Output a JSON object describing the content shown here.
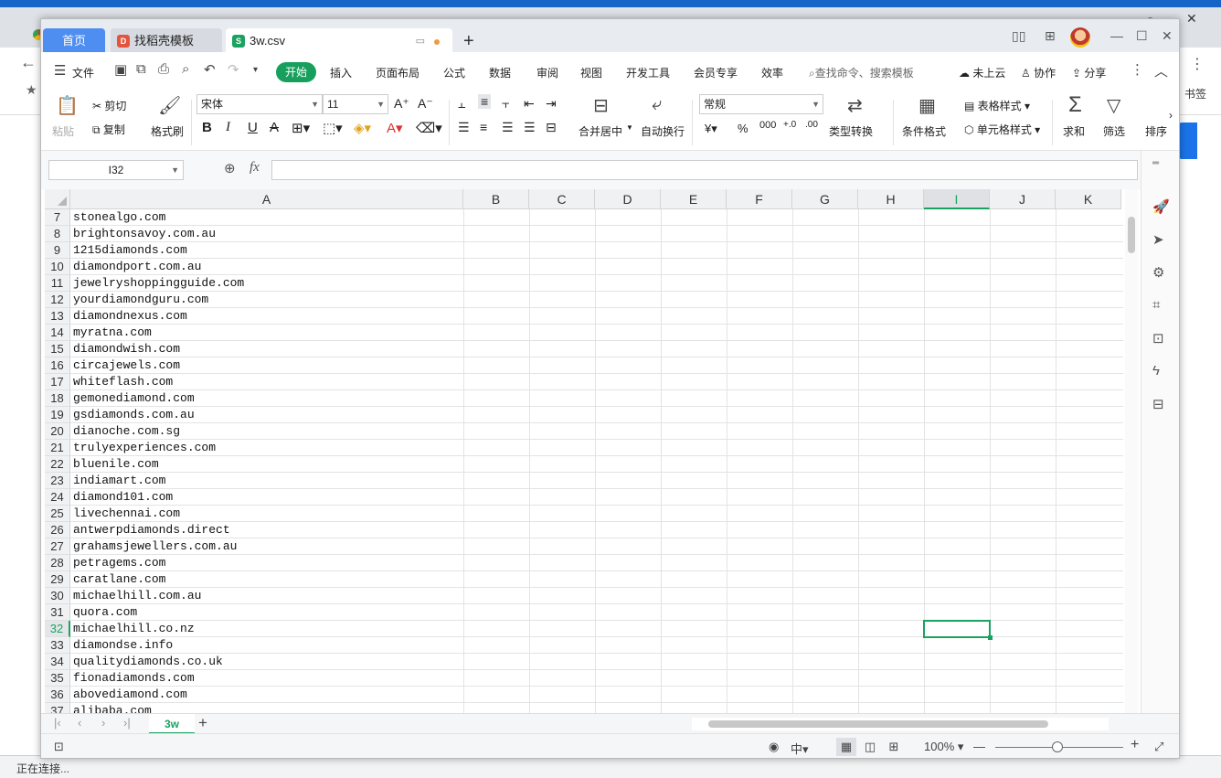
{
  "browser": {
    "bookmarks_label": "书签",
    "status_text": "正在连接..."
  },
  "titlebar": {
    "home_tab": "首页",
    "tabs": [
      {
        "label": "找稻壳模板"
      },
      {
        "label": "3w.csv"
      }
    ]
  },
  "menu": {
    "file": "文件",
    "items": [
      "开始",
      "插入",
      "页面布局",
      "公式",
      "数据",
      "审阅",
      "视图",
      "开发工具",
      "会员专享",
      "效率"
    ],
    "search": "查找命令、搜索模板",
    "cloud": "未上云",
    "collab": "协作",
    "share": "分享"
  },
  "ribbon": {
    "paste": "粘贴",
    "cut": "剪切",
    "copy": "复制",
    "format_painter": "格式刷",
    "font_name": "宋体",
    "font_size": "11",
    "merge_center": "合并居中",
    "wrap_text": "自动换行",
    "number_format": "常规",
    "type_convert": "类型转换",
    "conditional_format": "条件格式",
    "table_style": "表格样式",
    "cell_style": "单元格样式",
    "sum": "求和",
    "filter": "筛选",
    "sort": "排序"
  },
  "formula": {
    "name_box": "I32",
    "fx": "fx",
    "value": ""
  },
  "grid": {
    "columns": [
      "A",
      "B",
      "C",
      "D",
      "E",
      "F",
      "G",
      "H",
      "I",
      "J",
      "K"
    ],
    "active_column": "I",
    "active_row": "32",
    "rows": [
      {
        "n": "7",
        "a": "stonealgo.com"
      },
      {
        "n": "8",
        "a": "brightonsavoy.com.au"
      },
      {
        "n": "9",
        "a": "1215diamonds.com"
      },
      {
        "n": "10",
        "a": "diamondport.com.au"
      },
      {
        "n": "11",
        "a": "jewelryshoppingguide.com"
      },
      {
        "n": "12",
        "a": "yourdiamondguru.com"
      },
      {
        "n": "13",
        "a": "diamondnexus.com"
      },
      {
        "n": "14",
        "a": "myratna.com"
      },
      {
        "n": "15",
        "a": "diamondwish.com"
      },
      {
        "n": "16",
        "a": "circajewels.com"
      },
      {
        "n": "17",
        "a": "whiteflash.com"
      },
      {
        "n": "18",
        "a": "gemonediamond.com"
      },
      {
        "n": "19",
        "a": "gsdiamonds.com.au"
      },
      {
        "n": "20",
        "a": "dianoche.com.sg"
      },
      {
        "n": "21",
        "a": "trulyexperiences.com"
      },
      {
        "n": "22",
        "a": "bluenile.com"
      },
      {
        "n": "23",
        "a": "indiamart.com"
      },
      {
        "n": "24",
        "a": "diamond101.com"
      },
      {
        "n": "25",
        "a": "livechennai.com"
      },
      {
        "n": "26",
        "a": "antwerpdiamonds.direct"
      },
      {
        "n": "27",
        "a": "grahamsjewellers.com.au"
      },
      {
        "n": "28",
        "a": "petragems.com"
      },
      {
        "n": "29",
        "a": "caratlane.com"
      },
      {
        "n": "30",
        "a": "michaelhill.com.au"
      },
      {
        "n": "31",
        "a": "quora.com"
      },
      {
        "n": "32",
        "a": "michaelhill.co.nz"
      },
      {
        "n": "33",
        "a": "diamondse.info"
      },
      {
        "n": "34",
        "a": "qualitydiamonds.co.uk"
      },
      {
        "n": "35",
        "a": "fionadiamonds.com"
      },
      {
        "n": "36",
        "a": "abovediamond.com"
      },
      {
        "n": "37",
        "a": "alibaba.com"
      }
    ]
  },
  "sheet": {
    "tab": "3w"
  },
  "status": {
    "zoom": "100%"
  }
}
